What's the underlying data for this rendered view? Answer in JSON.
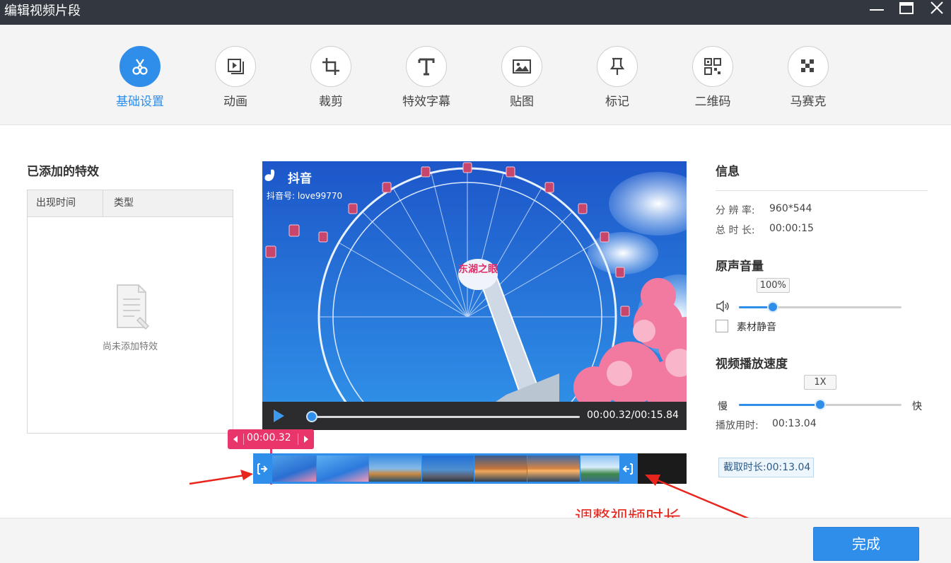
{
  "window": {
    "title": "编辑视频片段"
  },
  "tools": [
    {
      "label": "基础设置",
      "icon": "scissors-icon",
      "active": true
    },
    {
      "label": "动画",
      "icon": "animation-icon"
    },
    {
      "label": "裁剪",
      "icon": "crop-icon"
    },
    {
      "label": "特效字幕",
      "icon": "text-icon"
    },
    {
      "label": "贴图",
      "icon": "image-icon"
    },
    {
      "label": "标记",
      "icon": "pin-icon"
    },
    {
      "label": "二维码",
      "icon": "qrcode-icon"
    },
    {
      "label": "马赛克",
      "icon": "mosaic-icon"
    }
  ],
  "effects": {
    "title": "已添加的特效",
    "columns": [
      "出现时间",
      "类型"
    ],
    "empty_text": "尚未添加特效"
  },
  "video": {
    "watermark_brand": "抖音",
    "watermark_id": "抖音号: love99770",
    "sign_text": "东湖之眼",
    "time_display": "00:00.32/00:15.84",
    "progress_fraction": 0.01
  },
  "timeline": {
    "marker_time": "00:00.32"
  },
  "info": {
    "title": "信息",
    "resolution_label": "分 辨 率:",
    "resolution_value": "960*544",
    "duration_label": "总 时 长:",
    "duration_value": "00:00:15"
  },
  "volume": {
    "title": "原声音量",
    "value_label": "100%",
    "level_fraction": 0.21,
    "mute_label": "素材静音"
  },
  "speed": {
    "title": "视频播放速度",
    "value_label": "1X",
    "slow_label": "慢",
    "fast_label": "快",
    "play_time_label": "播放用时:",
    "play_time_value": "00:13.04",
    "level_fraction": 0.5
  },
  "clip_duration": "截取时长:00:13.04",
  "annotation": "调整视频时长",
  "done_label": "完成",
  "colors": {
    "accent": "#2f8ee9",
    "marker": "#e8356a",
    "annotation": "#e8251c"
  }
}
